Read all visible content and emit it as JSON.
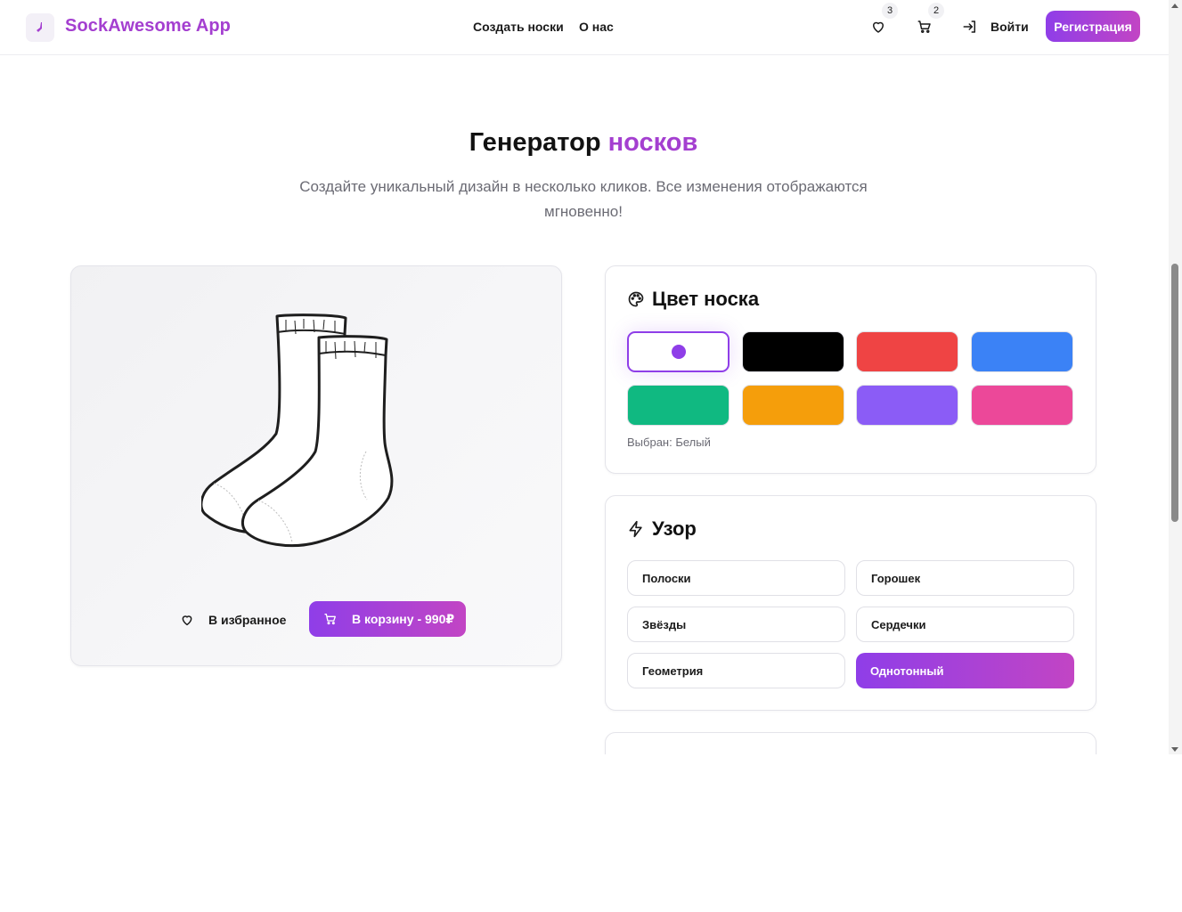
{
  "header": {
    "brand": "SockAwesome App",
    "nav": [
      "Создать носки",
      "О нас"
    ],
    "favorites_count": "3",
    "cart_count": "2",
    "login_label": "Войти",
    "register_label": "Регистрация",
    "icons": {
      "logo": "sock-icon",
      "favorites": "heart-icon",
      "cart": "cart-icon",
      "login": "login-icon"
    }
  },
  "hero": {
    "title_main": "Генератор",
    "title_accent": "носков",
    "subtitle": "Создайте уникальный дизайн в несколько кликов. Все изменения отображаются мгновенно!"
  },
  "preview": {
    "favorite_label": "В избранное",
    "cart_label": "В корзину - 990₽"
  },
  "color_panel": {
    "title": "Цвет носка",
    "icon": "palette-icon",
    "selected_text": "Выбран: Белый",
    "selected_index": 0,
    "swatches": [
      "#ffffff",
      "#000000",
      "#ef4444",
      "#3b82f6",
      "#10b981",
      "#f59e0b",
      "#8b5cf6",
      "#ec4899"
    ]
  },
  "pattern_panel": {
    "title": "Узор",
    "icon": "lightning-icon",
    "options": [
      "Полоски",
      "Горошек",
      "Звёзды",
      "Сердечки",
      "Геометрия",
      "Однотонный"
    ],
    "active_index": 5
  },
  "colors": {
    "brand_purple": "#a43fd0",
    "gradient_start": "#8f3ee8",
    "gradient_end": "#c245c4"
  }
}
